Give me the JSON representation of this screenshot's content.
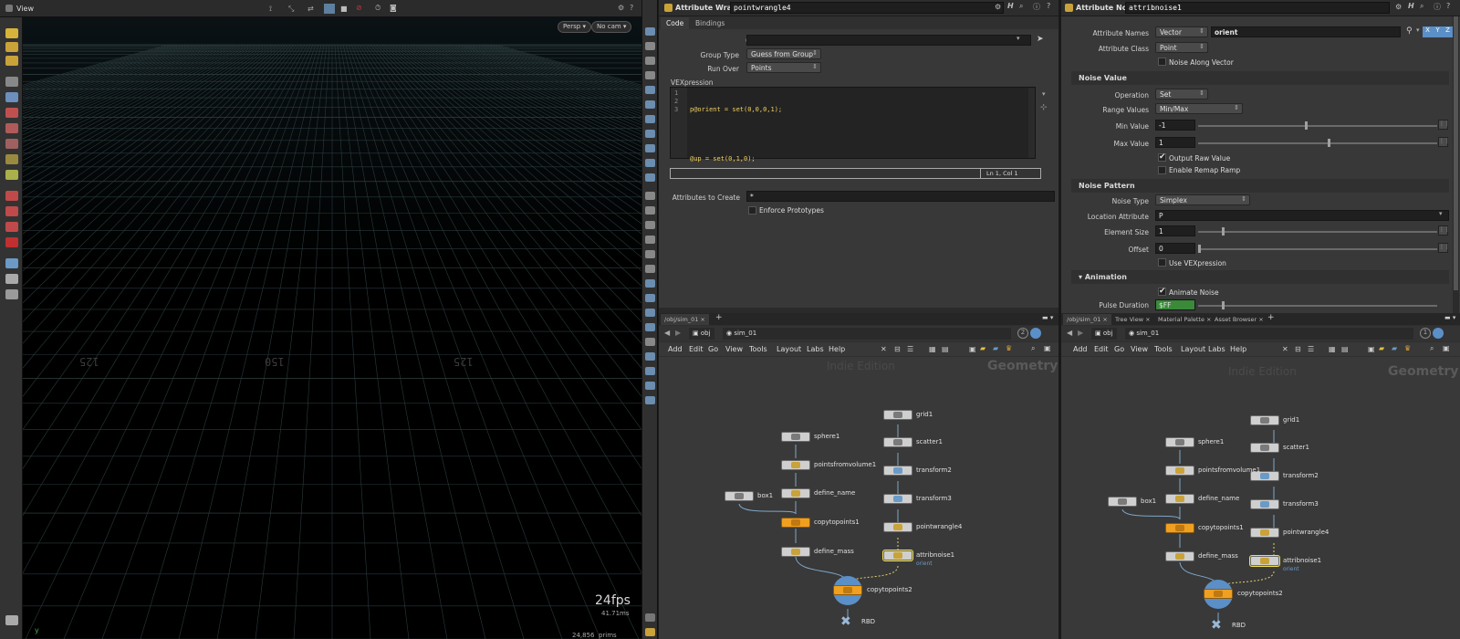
{
  "viewport": {
    "title": "View",
    "persp_label": "Persp",
    "cam_label": "No cam",
    "fps": "24fps",
    "ms": "41.71ms",
    "stats": "24,856  prims",
    "axis_y": "y",
    "grid_labels": [
      "125",
      "150",
      "125"
    ]
  },
  "wrangle": {
    "type_label": "Attribute Wrangle",
    "node_name": "pointwrangle4",
    "tabs": [
      "Code",
      "Bindings"
    ],
    "group_label": "Group",
    "group_value": "",
    "group_type_label": "Group Type",
    "group_type_value": "Guess from Group",
    "run_over_label": "Run Over",
    "run_over_value": "Points",
    "vex_label": "VEXpression",
    "code_lines": [
      {
        "num": "1",
        "text": "p@orient = set(0,0,0,1);"
      },
      {
        "num": "2",
        "text": ""
      },
      {
        "num": "3",
        "text": "@up = set(0,1,0);"
      }
    ],
    "status": "Ln 1, Col 1",
    "attrs_label": "Attributes to Create",
    "attrs_value": "*",
    "enforce_label": "Enforce Prototypes"
  },
  "noise": {
    "type_label": "Attribute Noise",
    "node_name": "attribnoise1",
    "attr_names_label": "Attribute Names",
    "attr_names_type": "Vector",
    "attr_names_value": "orient",
    "xyz": [
      "X",
      "Y",
      "Z"
    ],
    "attr_class_label": "Attribute Class",
    "attr_class_value": "Point",
    "noise_along_label": "Noise Along Vector",
    "noise_value_section": "Noise Value",
    "operation_label": "Operation",
    "operation_value": "Set",
    "range_label": "Range Values",
    "range_value": "Min/Max",
    "min_label": "Min Value",
    "min_value": "-1",
    "max_label": "Max Value",
    "max_value": "1",
    "output_raw_label": "Output Raw Value",
    "enable_remap_label": "Enable Remap Ramp",
    "noise_pattern_section": "Noise Pattern",
    "noise_type_label": "Noise Type",
    "noise_type_value": "Simplex",
    "location_label": "Location Attribute",
    "location_value": "P",
    "element_size_label": "Element Size",
    "element_size_value": "1",
    "offset_label": "Offset",
    "offset_value": "0",
    "use_vex_label": "Use VEXpression",
    "animation_section": "Animation",
    "animate_noise_label": "Animate Noise",
    "pulse_label": "Pulse Duration",
    "pulse_value": "$FF",
    "slider_levels": {
      "min": 0.45,
      "max": 0.55,
      "element": 0.1,
      "offset": 0.0,
      "pulse": 0.1
    }
  },
  "net_left": {
    "tabs": [
      "/obj/sim_01"
    ],
    "path_obj": "obj",
    "path_net": "sim_01",
    "menu": [
      "Add",
      "Edit",
      "Go",
      "View",
      "Tools",
      "Layout",
      "Labs",
      "Help"
    ],
    "edition": "Indie Edition",
    "context": "Geometry"
  },
  "net_right": {
    "tabs": [
      "/obj/sim_01",
      "Tree View",
      "Material Palette",
      "Asset Browser"
    ],
    "path_obj": "obj",
    "path_net": "sim_01",
    "menu": [
      "Add",
      "Edit",
      "Go",
      "View",
      "Tools",
      "Layout",
      "Labs",
      "Help"
    ],
    "edition": "Indie Edition",
    "context": "Geometry"
  },
  "nodes": {
    "grid1": "grid1",
    "scatter1": "scatter1",
    "transform2": "transform2",
    "transform3": "transform3",
    "pointwrangle4": "pointwrangle4",
    "attribnoise1": "attribnoise1",
    "orient_tag": "orient",
    "sphere1": "sphere1",
    "pointsfromvolume1": "pointsfromvolume1",
    "define_name": "define_name",
    "box1": "box1",
    "copytopoints1": "copytopoints1",
    "define_mass": "define_mass",
    "copytopoints2": "copytopoints2",
    "rbd": "RBD"
  },
  "colors": {
    "node_orange": "#f0a020",
    "selected": "#f3e04a",
    "accent_blue": "#5b8fc7",
    "pulse_green": "#3a8a3a"
  }
}
